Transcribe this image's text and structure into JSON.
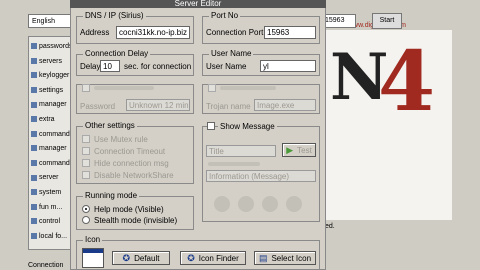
{
  "window": {
    "title": "Server Editor"
  },
  "background_app": {
    "language": "English",
    "port_field": "15963",
    "start_button": "Start",
    "logo_url": "www.digitalgh.com",
    "logo_letters": "N",
    "logo_number": "4",
    "status_left": "Connection",
    "trailing_text": "ed.",
    "tree_items": [
      "passwords",
      "servers",
      "keylogger",
      "settings",
      "manager",
      "extra",
      "commands",
      "manager",
      "commands",
      "server",
      "system",
      "fun m...",
      "control",
      "local fo..."
    ]
  },
  "dns_ip": {
    "title": "DNS / IP (Sirius)",
    "label": "Address",
    "value": "cocni31kk.no-ip.biz"
  },
  "port": {
    "title": "Port No",
    "label": "Connection Port",
    "value": "15963"
  },
  "connection_delay": {
    "title": "Connection Delay",
    "label": "Delay",
    "value": "10",
    "unit": "sec. for connection"
  },
  "user_name": {
    "title": "User Name",
    "label": "User Name",
    "value": "yl"
  },
  "left_option_box": {
    "field_label": "Password",
    "field_value": "Unknown 12 min"
  },
  "right_option_box": {
    "field_label": "Trojan name",
    "field_value": "Image.exe"
  },
  "other_settings": {
    "title": "Other settings",
    "items": [
      "Use Mutex rule",
      "Connection Timeout",
      "Hide connection msg",
      "Disable NetworkShare"
    ]
  },
  "show_message": {
    "title": "Show Message",
    "title_field": "Title",
    "test_button": "Test",
    "type_select": "Information (Message)"
  },
  "running_mode": {
    "title": "Running mode",
    "options": [
      "Help mode (Visible)",
      "Stealth mode (invisible)"
    ],
    "selected_index": 0
  },
  "icon": {
    "title": "Icon",
    "buttons": [
      "Default",
      "Icon Finder",
      "Select Icon"
    ]
  }
}
